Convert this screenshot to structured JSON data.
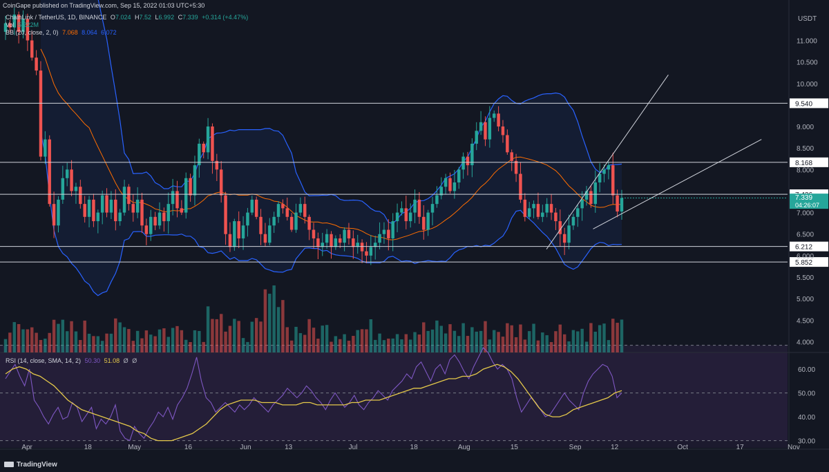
{
  "publisher_line": "CoinGape published on TradingView.com, Sep 15, 2022 01:03 UTC+5:30",
  "header": {
    "symbol": "ChainLink / TetherUS, 1D, BINANCE",
    "ohlc": {
      "o_label": "O",
      "o": "7.024",
      "h_label": "H",
      "h": "7.52",
      "l_label": "L",
      "l": "6.992",
      "c_label": "C",
      "c": "7.339",
      "change": "+0.314 (+4.47%)"
    },
    "vol_label": "Vol",
    "vol_value": "5.222M",
    "bb_label": "BB (20, close, 2, 0)",
    "bb_values": [
      "7.068",
      "8.064",
      "6.072"
    ],
    "rsi_label": "RSI (14, close, SMA, 14, 2)",
    "rsi_values": [
      "50.30",
      "51.08",
      "Ø",
      "Ø"
    ]
  },
  "colors": {
    "background": "#131722",
    "up": "#26a69a",
    "down": "#ef5350",
    "bb_band": "#2962ff",
    "bb_basis": "#ff6d00",
    "rsi": "#7e57c2",
    "rsi_ma": "#e5c94a",
    "level_line": "#d1d4dc",
    "trendline": "#d1d4dc",
    "price_tag": "#26a69a"
  },
  "branding": "TradingView",
  "chart_data": [
    {
      "type": "candlestick",
      "title": "ChainLink / TetherUS, 1D, BINANCE",
      "currency_label": "USDT",
      "y_ticks": [
        "11.000",
        "10.500",
        "10.000",
        "9.000",
        "8.500",
        "8.000",
        "6.500",
        "6.000",
        "5.500",
        "5.000",
        "4.500",
        "4.000"
      ],
      "ylim": [
        3.75,
        11.65
      ],
      "horizontal_levels": [
        {
          "label": "9.540",
          "value": 9.54
        },
        {
          "label": "8.168",
          "value": 8.168
        },
        {
          "label": "7.426",
          "value": 7.426
        },
        {
          "label": "6.212",
          "value": 6.212
        },
        {
          "label": "5.852",
          "value": 5.852
        }
      ],
      "price_axis_labels": [
        {
          "label": "7.000",
          "value": 7.0
        },
        {
          "label": "7.339",
          "value": 7.339
        },
        {
          "label": "04:26:07",
          "value": 7.18
        }
      ],
      "last_price": "7.339",
      "countdown": "04:26:07",
      "x_axis_labels": [
        "Apr",
        "18",
        "May",
        "16",
        "Jun",
        "13",
        "Jul",
        "18",
        "Aug",
        "15",
        "Sep",
        "12",
        "Oct",
        "17",
        "Nov"
      ],
      "date_range": [
        "2022-03-26",
        "2022-09-14"
      ],
      "ohlc_closes": [
        11.4,
        11.3,
        11.6,
        11.2,
        11.5,
        11.0,
        10.6,
        10.3,
        8.3,
        8.7,
        7.2,
        6.7,
        7.3,
        7.8,
        8.0,
        7.5,
        7.6,
        7.2,
        6.9,
        7.3,
        6.8,
        7.0,
        7.4,
        7.0,
        7.3,
        6.8,
        7.0,
        7.6,
        7.2,
        7.0,
        7.3,
        6.7,
        6.5,
        6.9,
        6.7,
        7.0,
        6.8,
        7.2,
        7.5,
        7.1,
        7.0,
        7.8,
        7.4,
        8.1,
        8.6,
        8.4,
        9.0,
        8.2,
        8.0,
        7.4,
        6.5,
        6.2,
        6.8,
        6.4,
        6.7,
        7.0,
        7.3,
        6.9,
        6.5,
        6.3,
        6.7,
        6.9,
        7.2,
        7.1,
        6.9,
        6.6,
        7.0,
        7.2,
        6.9,
        6.6,
        6.4,
        6.2,
        6.3,
        6.5,
        6.2,
        6.4,
        6.3,
        6.6,
        6.4,
        6.2,
        6.3,
        6.1,
        6.0,
        6.2,
        6.3,
        6.5,
        6.6,
        6.4,
        6.8,
        7.0,
        7.1,
        6.8,
        7.0,
        7.3,
        6.9,
        6.6,
        7.0,
        7.2,
        7.4,
        7.6,
        7.8,
        7.5,
        7.7,
        8.0,
        8.3,
        8.1,
        8.6,
        8.9,
        9.1,
        8.7,
        9.2,
        9.3,
        9.0,
        8.8,
        8.4,
        8.2,
        7.9,
        7.3,
        6.9,
        7.1,
        7.2,
        6.9,
        7.0,
        7.2,
        7.0,
        6.8,
        6.5,
        6.3,
        6.7,
        6.9,
        7.1,
        7.3,
        7.5,
        7.2,
        7.7,
        7.9,
        8.0,
        8.1,
        7.4,
        7.025,
        7.339
      ],
      "note": "ohlc_closes are approximate daily closes read off the chart; open = previous close, highs/lows estimated from wicks.",
      "bollinger": {
        "basis": "7.068",
        "upper": "8.064",
        "lower": "6.072"
      },
      "trendlines": [
        {
          "from": [
            "2022-08-24",
            6.15
          ],
          "to": [
            "2022-09-09",
            8.3
          ],
          "extended_to": [
            "2022-09-27",
            10.2
          ]
        },
        {
          "from": [
            "2022-09-06",
            6.62
          ],
          "to": [
            "2022-09-14",
            7.0
          ],
          "extended_to": [
            "2022-10-23",
            8.7
          ]
        }
      ]
    },
    {
      "type": "line",
      "title": "RSI (14, close, SMA, 14, 2)",
      "y_ticks": [
        "60.00",
        "50.00",
        "40.00",
        "30.00"
      ],
      "ylim": [
        27,
        67
      ],
      "reference_lines": [
        70,
        50,
        30
      ],
      "series": [
        {
          "name": "RSI",
          "values": [
            56,
            59,
            62,
            57,
            53,
            60,
            47,
            44,
            40,
            37,
            41,
            44,
            39,
            40,
            46,
            44,
            38,
            41,
            44,
            35,
            39,
            37,
            40,
            45,
            34,
            31,
            30,
            36,
            33,
            31,
            35,
            38,
            42,
            40,
            44,
            39,
            45,
            48,
            52,
            58,
            65,
            55,
            48,
            46,
            42,
            44,
            46,
            44,
            42,
            45,
            43,
            45,
            48,
            46,
            44,
            42,
            45,
            47,
            49,
            52,
            50,
            48,
            50,
            53,
            51,
            48,
            46,
            43,
            47,
            50,
            47,
            44,
            46,
            49,
            45,
            43,
            46,
            48,
            51,
            49,
            47,
            51,
            53,
            55,
            58,
            56,
            61,
            63,
            59,
            55,
            60,
            62,
            58,
            64,
            66,
            63,
            59,
            56,
            61,
            65,
            69,
            67,
            63,
            60,
            62,
            60,
            56,
            48,
            42,
            45,
            48,
            46,
            43,
            40,
            41,
            44,
            47,
            50,
            47,
            45,
            43,
            50,
            55,
            58,
            60,
            62,
            61,
            57,
            48,
            50
          ],
          "last": "50.30"
        },
        {
          "name": "SMA",
          "values": [
            58,
            60,
            61,
            60,
            58,
            57,
            55,
            53,
            50,
            47,
            45,
            43,
            42,
            41,
            40,
            39,
            38,
            37,
            36,
            34,
            33,
            31,
            30,
            30,
            30,
            31,
            32,
            33,
            35,
            37,
            40,
            43,
            45,
            46,
            47,
            47,
            47,
            46,
            46,
            46,
            45,
            45,
            45,
            46,
            46,
            45,
            45,
            45,
            45,
            45,
            46,
            46,
            47,
            47,
            47,
            48,
            49,
            50,
            51,
            52,
            52,
            53,
            54,
            55,
            56,
            56,
            57,
            57,
            58,
            60,
            61,
            62,
            61,
            59,
            56,
            52,
            48,
            44,
            41,
            40,
            40,
            41,
            43,
            44,
            45,
            46,
            47,
            48,
            50,
            51
          ],
          "last": "51.08"
        }
      ]
    }
  ]
}
